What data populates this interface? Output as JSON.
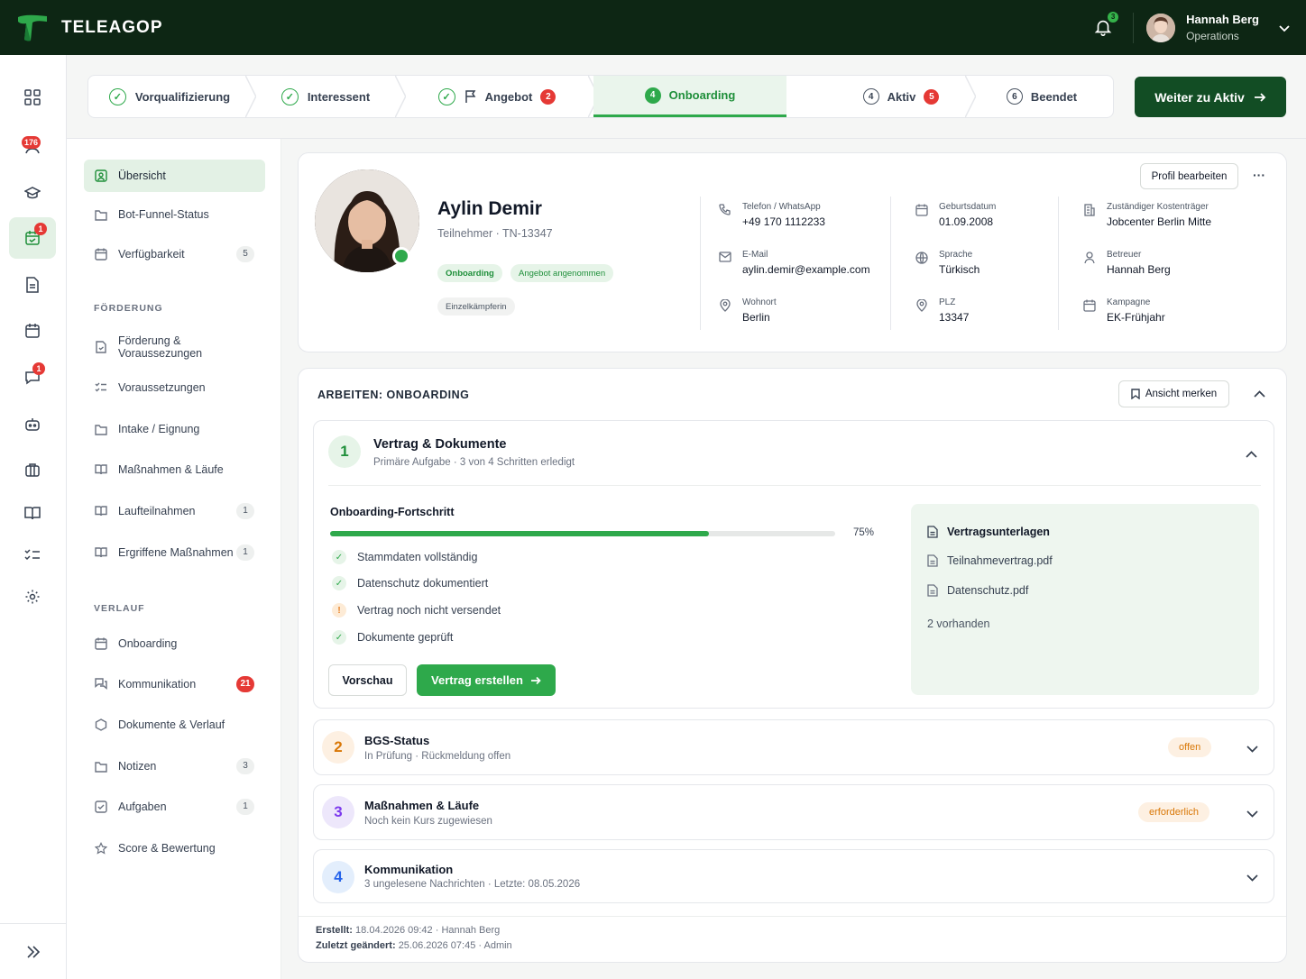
{
  "app": {
    "name": "TELEAGOP"
  },
  "user": {
    "name": "Hannah Berg",
    "role": "Operations",
    "notifications": "3"
  },
  "rail": {
    "badge_participants": "176",
    "badge_onboarding": "1",
    "badge_messages": "1"
  },
  "stepper": {
    "steps": [
      {
        "label": "Vorqualifizierung"
      },
      {
        "label": "Interessent"
      },
      {
        "label": "Angebot",
        "count": "2"
      },
      {
        "label": "Onboarding",
        "num": "4"
      },
      {
        "label": "Aktiv",
        "num": "4",
        "count": "5"
      },
      {
        "label": "Beendet",
        "num": "6"
      }
    ],
    "cta": "Weiter zu Aktiv"
  },
  "nav": {
    "items": [
      {
        "label": "Übersicht"
      },
      {
        "label": "Bot-Funnel-Status"
      },
      {
        "label": "Verfügbarkeit",
        "count": "5"
      }
    ],
    "section_foerderung": "FÖRDERUNG",
    "foerderung": [
      {
        "label": "Förderung & Voraussezungen"
      },
      {
        "label": "Voraussetzungen"
      },
      {
        "label": "Intake / Eignung"
      },
      {
        "label": "Maßnahmen & Läufe"
      },
      {
        "label": "Laufteilnahmen",
        "count": "1"
      },
      {
        "label": "Ergriffene Maßnahmen",
        "count": "1"
      }
    ],
    "section_verlauf": "VERLAUF",
    "verlauf": [
      {
        "label": "Onboarding"
      },
      {
        "label": "Kommunikation",
        "count": "21"
      },
      {
        "label": "Dokumente & Verlauf"
      },
      {
        "label": "Notizen",
        "count": "3"
      },
      {
        "label": "Aufgaben",
        "count": "1"
      },
      {
        "label": "Score & Bewertung"
      }
    ]
  },
  "profile": {
    "name": "Aylin Demir",
    "subtitle": "Teilnehmer · TN-13347",
    "tags": [
      "Onboarding",
      "Angebot angenommen",
      "Einzelkämpferin"
    ],
    "edit_button": "Profil bearbeiten",
    "more": "···",
    "fields": {
      "phone": {
        "label": "Telefon / WhatsApp",
        "value": "+49 170 1112233"
      },
      "email": {
        "label": "E-Mail",
        "value": "aylin.demir@example.com"
      },
      "wohnort": {
        "label": "Wohnort",
        "value": "Berlin"
      },
      "birth": {
        "label": "Geburtsdatum",
        "value": "01.09.2008"
      },
      "lang": {
        "label": "Sprache",
        "value": "Türkisch"
      },
      "plz": {
        "label": "PLZ",
        "value": "13347"
      },
      "payer": {
        "label": "Zuständiger Kostenträger",
        "value": "Jobcenter Berlin Mitte"
      },
      "betreuer": {
        "label": "Betreuer",
        "value": "Hannah Berg"
      },
      "campaign": {
        "label": "Kampagne",
        "value": "EK-Frühjahr"
      }
    }
  },
  "work": {
    "title": "ARBEITEN: ONBOARDING",
    "bookmark": "Ansicht merken",
    "task1": {
      "num": "1",
      "title": "Vertrag & Dokumente",
      "subtitle": "Primäre Aufgabe · 3 von 4 Schritten erledigt",
      "progress_label": "Onboarding-Fortschritt",
      "progress_pct": "75%",
      "progress_value": 0.75,
      "checks": [
        {
          "label": "Stammdaten vollständig",
          "state": "done",
          "mark": "✓"
        },
        {
          "label": "Datenschutz dokumentiert",
          "state": "done",
          "mark": "✓"
        },
        {
          "label": "Vertrag noch nicht versendet",
          "state": "warn",
          "mark": "!"
        },
        {
          "label": "Dokumente geprüft",
          "state": "done",
          "mark": "✓"
        }
      ],
      "preview": "Vorschau",
      "create": "Vertrag erstellen",
      "docs_title": "Vertragsunterlagen",
      "docs": [
        "Teilnahmevertrag.pdf",
        "Datenschutz.pdf"
      ],
      "docs_count": "2 vorhanden"
    },
    "task2": {
      "num": "2",
      "title": "BGS-Status",
      "subtitle": "In Prüfung · Rückmeldung offen",
      "status": "offen"
    },
    "task3": {
      "num": "3",
      "title": "Maßnahmen & Läufe",
      "subtitle": "Noch kein Kurs zugewiesen",
      "status": "erforderlich"
    },
    "task4": {
      "num": "4",
      "title": "Kommunikation",
      "subtitle": "3 ungelesene Nachrichten · Letzte: 08.05.2026"
    },
    "footer": {
      "created_label": "Erstellt:",
      "created": "18.04.2026 09:42 · Hannah Berg",
      "changed_label": "Zuletzt geändert:",
      "changed": "25.06.2026 07:45 · Admin"
    }
  },
  "colors": {
    "brand_dark": "#0d2614",
    "accent": "#2ea94b",
    "cta": "#124d24",
    "badge": "#e53935",
    "warn": "#d97706"
  }
}
